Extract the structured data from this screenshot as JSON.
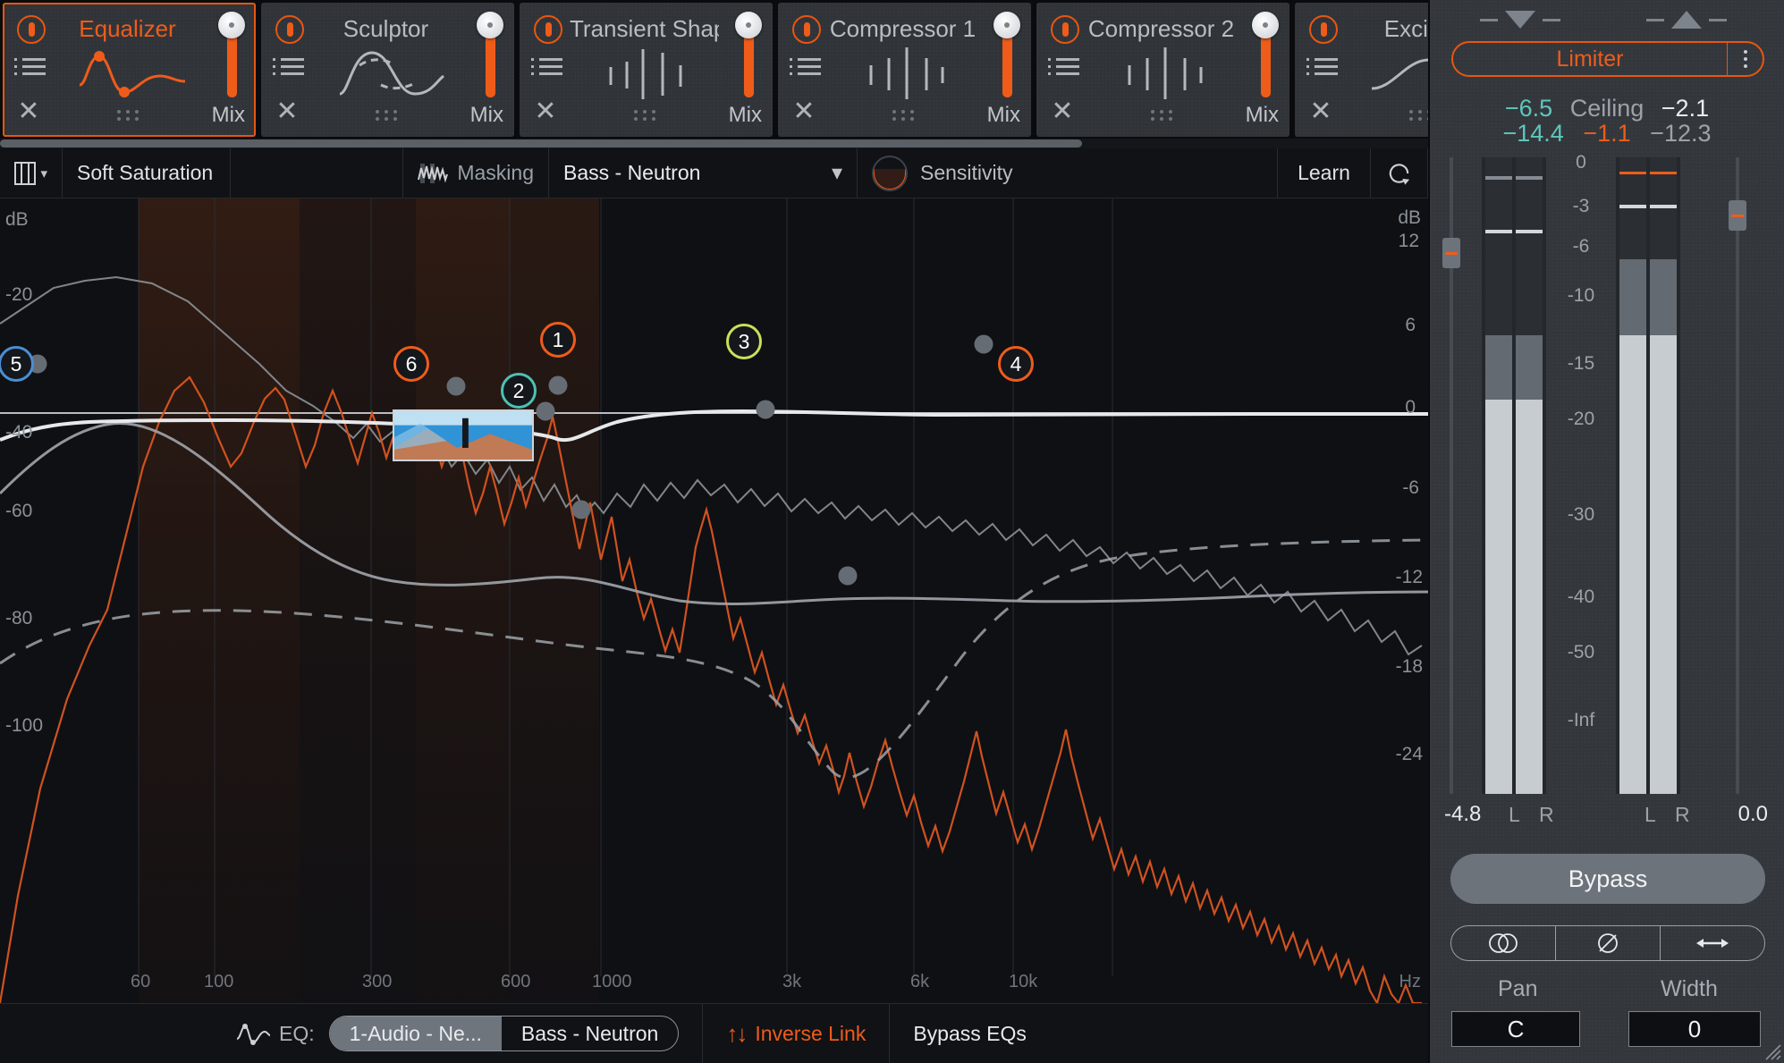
{
  "modules": [
    {
      "name": "Equalizer",
      "selected": true,
      "power": true,
      "glyph": "eq-curve-icon"
    },
    {
      "name": "Sculptor",
      "selected": false,
      "power": true,
      "glyph": "sculptor-curve-icon"
    },
    {
      "name": "Transient Shaper",
      "selected": false,
      "power": true,
      "glyph": "transient-bars-icon"
    },
    {
      "name": "Compressor 1",
      "selected": false,
      "power": true,
      "glyph": "compressor-bars-icon"
    },
    {
      "name": "Compressor 2",
      "selected": false,
      "power": true,
      "glyph": "compressor-bars-icon"
    },
    {
      "name": "Exciter",
      "selected": false,
      "power": true,
      "glyph": "exciter-icon"
    }
  ],
  "module_common": {
    "mix_label": "Mix",
    "close_label": "✕"
  },
  "toolbar": {
    "layout_label": "layout-selector",
    "mode": "Soft Saturation",
    "masking_label": "Masking",
    "preset": "Bass - Neutron",
    "sensitivity_label": "Sensitivity",
    "learn_label": "Learn",
    "reset_label": "reset"
  },
  "graph": {
    "left_axis_title": "dB",
    "right_axis_title": "dB",
    "left_ticks": [
      "-20",
      "-40",
      "-60",
      "-80",
      "-100"
    ],
    "right_ticks": [
      "12",
      "6",
      "0",
      "-6",
      "-12",
      "-18",
      "-24"
    ],
    "freq_ticks": [
      "60",
      "100",
      "300",
      "600",
      "1000",
      "3k",
      "6k",
      "10k"
    ],
    "freq_unit": "Hz",
    "nodes": [
      {
        "id": "5",
        "color": "#4a8fd4"
      },
      {
        "id": "6",
        "color": "#ef5c1a"
      },
      {
        "id": "1",
        "color": "#ef5c1a"
      },
      {
        "id": "2",
        "color": "#4ec0b4"
      },
      {
        "id": "3",
        "color": "#c9e05a"
      },
      {
        "id": "4",
        "color": "#ef5c1a"
      }
    ]
  },
  "bottom_bar": {
    "eq_label": "EQ:",
    "seg_left": "1-Audio - Ne...",
    "seg_right": "Bass - Neutron",
    "inverse_link": "Inverse Link",
    "bypass_eqs": "Bypass EQs"
  },
  "right_panel": {
    "limiter_label": "Limiter",
    "readout_top": {
      "left": "−6.5",
      "center": "Ceiling",
      "right": "−2.1"
    },
    "readout_bottom": {
      "left": "−14.4",
      "center": "−1.1",
      "right": "−12.3"
    },
    "scale": [
      "0",
      "-3",
      "-6",
      "-10",
      "-15",
      "-20",
      "-30",
      "-40",
      "-50",
      "-Inf"
    ],
    "input_value": "-4.8",
    "output_value": "0.0",
    "channel_left": "L",
    "channel_right": "R",
    "bypass_label": "Bypass",
    "stereo_icons": [
      "stereo-link-icon",
      "phase-invert-icon",
      "width-arrows-icon"
    ],
    "pan_label": "Pan",
    "width_label": "Width",
    "pan_value": "C",
    "width_value": "0"
  },
  "colors": {
    "accent": "#ef5c1a",
    "panel": "#33373c",
    "graph_bg": "#0e1014",
    "text": "#e9ecef"
  }
}
